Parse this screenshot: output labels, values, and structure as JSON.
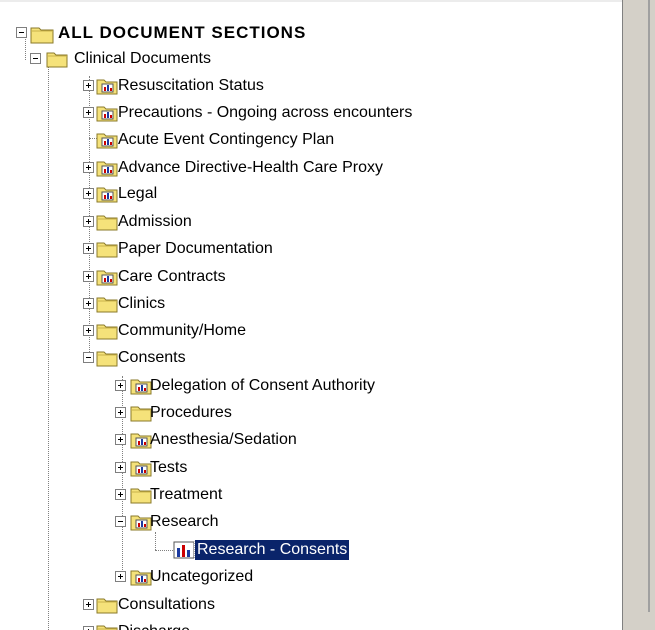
{
  "tree": {
    "root": {
      "label": "ALL DOCUMENT SECTIONS",
      "expanded": true
    },
    "items": [
      {
        "label": "Clinical Documents",
        "level": 1,
        "icon": "folder-icon",
        "expander": "minus"
      },
      {
        "label": "Resuscitation Status",
        "level": 2,
        "icon": "report-folder-icon",
        "expander": "plus"
      },
      {
        "label": "Precautions - Ongoing across encounters",
        "level": 2,
        "icon": "report-folder-icon",
        "expander": "plus"
      },
      {
        "label": "Acute Event Contingency Plan",
        "level": 2,
        "icon": "report-folder-icon",
        "expander": "none"
      },
      {
        "label": "Advance Directive-Health Care Proxy",
        "level": 2,
        "icon": "report-folder-icon",
        "expander": "plus"
      },
      {
        "label": "Legal",
        "level": 2,
        "icon": "report-folder-icon",
        "expander": "plus"
      },
      {
        "label": "Admission",
        "level": 2,
        "icon": "folder-icon",
        "expander": "plus"
      },
      {
        "label": "Paper Documentation",
        "level": 2,
        "icon": "folder-icon",
        "expander": "plus"
      },
      {
        "label": "Care Contracts",
        "level": 2,
        "icon": "report-folder-icon",
        "expander": "plus"
      },
      {
        "label": "Clinics",
        "level": 2,
        "icon": "folder-icon",
        "expander": "plus"
      },
      {
        "label": "Community/Home",
        "level": 2,
        "icon": "folder-icon",
        "expander": "plus"
      },
      {
        "label": "Consents",
        "level": 2,
        "icon": "folder-icon",
        "expander": "minus"
      },
      {
        "label": "Delegation of Consent Authority",
        "level": 3,
        "icon": "report-folder-icon",
        "expander": "plus"
      },
      {
        "label": "Procedures",
        "level": 3,
        "icon": "folder-icon",
        "expander": "plus"
      },
      {
        "label": "Anesthesia/Sedation",
        "level": 3,
        "icon": "report-folder-icon",
        "expander": "plus"
      },
      {
        "label": "Tests",
        "level": 3,
        "icon": "report-folder-icon",
        "expander": "plus"
      },
      {
        "label": "Treatment",
        "level": 3,
        "icon": "folder-icon",
        "expander": "plus"
      },
      {
        "label": "Research",
        "level": 3,
        "icon": "report-folder-icon",
        "expander": "minus"
      },
      {
        "label": "Research - Consents",
        "level": 4,
        "icon": "bar-chart-icon",
        "expander": "none",
        "selected": true
      },
      {
        "label": "Uncategorized",
        "level": 3,
        "icon": "report-folder-icon",
        "expander": "plus"
      },
      {
        "label": "Consultations",
        "level": 2,
        "icon": "folder-icon",
        "expander": "plus"
      },
      {
        "label": "Discharge",
        "level": 2,
        "icon": "folder-icon",
        "expander": "plus"
      }
    ]
  },
  "colors": {
    "folder": "#f5e27a",
    "selection": "#0a246a",
    "scrollbar": "#d4d0c8"
  }
}
